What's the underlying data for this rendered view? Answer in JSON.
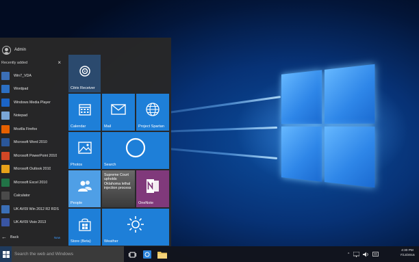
{
  "user": {
    "name": "Admin"
  },
  "recent": {
    "header": "Recently added",
    "close_icon": "close-icon"
  },
  "apps": [
    {
      "label": "Win7_VDA",
      "icon": "remote-desktop-icon",
      "color": "#3b6fb6"
    },
    {
      "label": "Wordpad",
      "icon": "wordpad-icon",
      "color": "#2c6fc2"
    },
    {
      "label": "Windows Media Player",
      "icon": "media-player-icon",
      "color": "#1b64c6"
    },
    {
      "label": "Notepad",
      "icon": "notepad-icon",
      "color": "#7aa6d6"
    },
    {
      "label": "Mozilla Firefox",
      "icon": "firefox-icon",
      "color": "#e66000"
    },
    {
      "label": "Microsoft Word 2010",
      "icon": "word-icon",
      "color": "#2b579a"
    },
    {
      "label": "Microsoft PowerPoint 2010",
      "icon": "powerpoint-icon",
      "color": "#d24726"
    },
    {
      "label": "Microsoft Outlook 2010",
      "icon": "outlook-icon",
      "color": "#e8a21a"
    },
    {
      "label": "Microsoft Excel 2010",
      "icon": "excel-icon",
      "color": "#217346"
    },
    {
      "label": "Calculator",
      "icon": "calculator-icon",
      "color": "#4a4a4a"
    },
    {
      "label": "UK AV09 Win 2012 R2 RDS",
      "icon": "remote-desktop-icon",
      "color": "#3b6fb6"
    },
    {
      "label": "UK AV09 Visio 2013",
      "icon": "visio-icon",
      "color": "#3955a3"
    }
  ],
  "nav": {
    "back_label": "Back",
    "new_label": "New"
  },
  "tiles": {
    "citrix": "Citrix Receiver",
    "calendar": "Calendar",
    "mail": "Mail",
    "spartan": "Project Spartan",
    "photos": "Photos",
    "search": "Search",
    "people": "People",
    "news": "Supreme Court upholds Oklahoma lethal injection process",
    "onenote": "OneNote",
    "store": "Store (Beta)",
    "weather": "Weather"
  },
  "taskbar": {
    "search_placeholder": "Search the web and Windows",
    "time": "4:30 PM",
    "date": "7/13/2015"
  },
  "colors": {
    "tile_blue": "#1e7fd8",
    "onenote": "#80397b",
    "accent": "#0078d7"
  }
}
